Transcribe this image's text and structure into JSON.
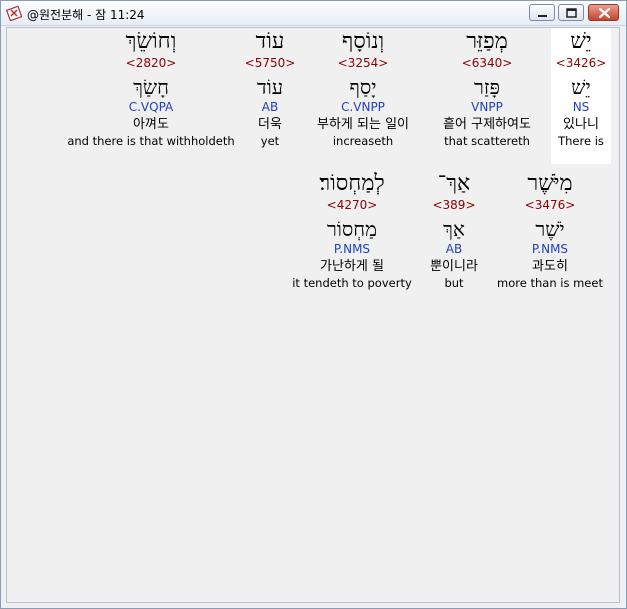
{
  "window": {
    "title": "@원전분해 - 잠 11:24",
    "icon": "bible-cross-icon",
    "buttons": {
      "minimize": "minimize-icon",
      "maximize": "maximize-icon",
      "close": "close-icon"
    },
    "close_color": "#c6452d"
  },
  "rows": [
    {
      "words": [
        {
          "heb": "יֵשׁ",
          "num": "<3426>",
          "lemma": "יֵשׁ",
          "pos": "NS",
          "kor": "있나니",
          "eng": "There is",
          "highlight": true
        },
        {
          "heb": "מְפַזֵּר",
          "num": "<6340>",
          "lemma": "פָּזַר",
          "pos": "VNPP",
          "kor": "흩어 구제하여도",
          "eng": "that scattereth",
          "highlight": false
        },
        {
          "heb": "וְנוֹסָף",
          "num": "<3254>",
          "lemma": "יָסַף",
          "pos": "C.VNPP",
          "kor": "부하게 되는 일이",
          "eng": "increaseth",
          "highlight": false
        },
        {
          "heb": "עוֹד",
          "num": "<5750>",
          "lemma": "עוֹד",
          "pos": "AB",
          "kor": "더욱",
          "eng": "yet",
          "highlight": false
        },
        {
          "heb": "וְחוֹשֵׂךְ",
          "num": "<2820>",
          "lemma": "חָשַׂךְ",
          "pos": "C.VQPA",
          "kor": "아껴도",
          "eng": "and there is that withholdeth",
          "highlight": false
        }
      ]
    },
    {
      "words": [
        {
          "heb": "מִיֹּשֶׁר",
          "num": "<3476>",
          "lemma": "יֹשֶׁר",
          "pos": "P.NMS",
          "kor": "과도히",
          "eng": "more than is meet",
          "highlight": false
        },
        {
          "heb": "אַךְ־",
          "num": "<389>",
          "lemma": "אַךְ",
          "pos": "AB",
          "kor": "뿐이니라",
          "eng": "but",
          "highlight": false
        },
        {
          "heb": "לְמַחְסוֹר׃",
          "num": "<4270>",
          "lemma": "מַחְסוֹר",
          "pos": "P.NMS",
          "kor": "가난하게 될",
          "eng": "it tendeth to poverty",
          "highlight": false
        }
      ]
    }
  ],
  "colors": {
    "strong_number": "#8b0000",
    "pos": "#1f3fbf",
    "highlight": "#ffffff"
  }
}
